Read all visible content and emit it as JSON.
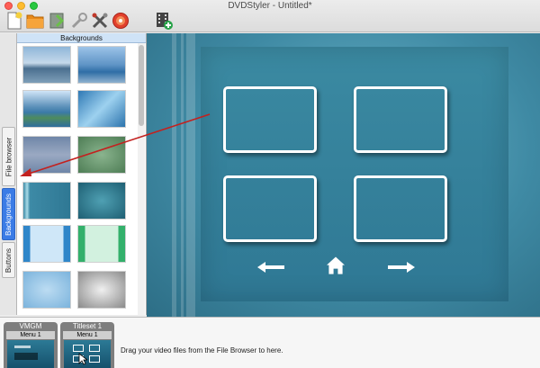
{
  "window": {
    "title": "DVDStyler - Untitled*"
  },
  "toolbar": [
    {
      "name": "new-project-button",
      "icon": "new-document-icon"
    },
    {
      "name": "open-project-button",
      "icon": "open-folder-icon"
    },
    {
      "name": "save-project-button",
      "icon": "save-icon"
    },
    {
      "name": "project-properties-button",
      "icon": "properties-icon"
    },
    {
      "name": "settings-button",
      "icon": "tools-icon"
    },
    {
      "name": "burn-button",
      "icon": "burn-disc-icon"
    },
    {
      "name": "add-file-button",
      "icon": "add-video-icon"
    }
  ],
  "tabs": {
    "file_browser": "File browser",
    "backgrounds": "Backgrounds",
    "buttons": "Buttons"
  },
  "backgrounds_panel": {
    "title": "Backgrounds"
  },
  "titlesets": {
    "vmgm": {
      "title": "VMGM",
      "menu": "Menu 1"
    },
    "titleset1": {
      "title": "Titleset 1",
      "menu": "Menu 1"
    }
  },
  "hint": "Drag your video files from the File Browser to here.",
  "colors": {
    "accent": "#3b7ce6",
    "arrow": "#c3211f",
    "menu_bg": "#3b8aa2"
  }
}
